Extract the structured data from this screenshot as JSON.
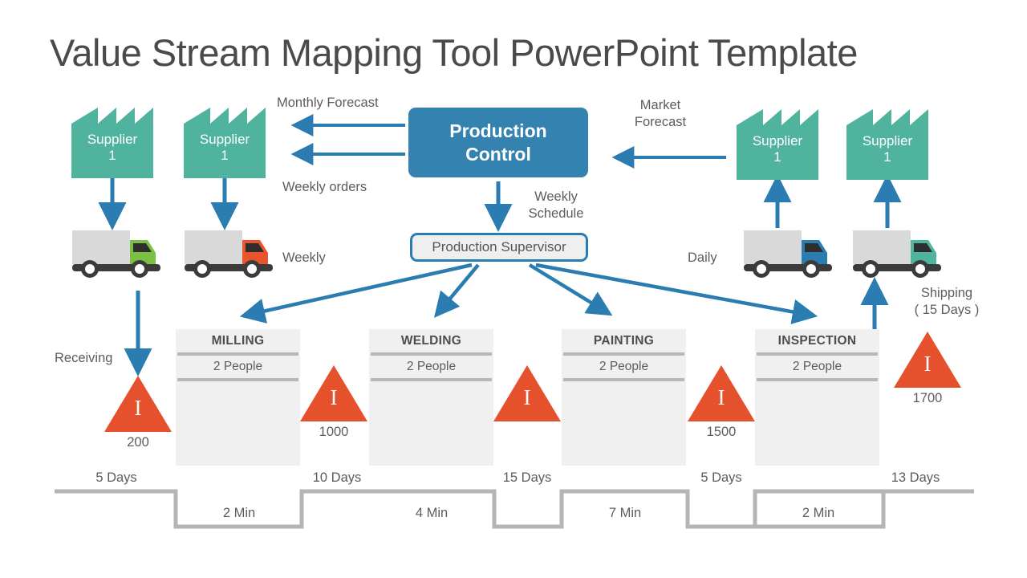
{
  "page_title": "Value Stream Mapping Tool PowerPoint Template",
  "colors": {
    "supplier_teal": "#4fb39d",
    "control_blue": "#3382b0",
    "arrow_blue": "#2b7cb0",
    "inventory_orange": "#e5512c",
    "process_gray": "#f0f0f0",
    "rule_gray": "#b8b8b8",
    "timeline_gray": "#b5b5b5",
    "text_gray": "#5c5c5c",
    "title_gray": "#4a4a4a",
    "truck_body_gray": "#d9d9d9",
    "truck_chassis": "#3b3b3b"
  },
  "production_control": {
    "line1": "Production",
    "line2": "Control"
  },
  "production_supervisor": {
    "label": "Production Supervisor"
  },
  "suppliers": [
    {
      "id": "supplier-left-1",
      "line1": "Supplier",
      "line2": "1"
    },
    {
      "id": "supplier-left-2",
      "line1": "Supplier",
      "line2": "1"
    },
    {
      "id": "supplier-right-1",
      "line1": "Supplier",
      "line2": "1"
    },
    {
      "id": "supplier-right-2",
      "line1": "Supplier",
      "line2": "1"
    }
  ],
  "flow_labels": {
    "monthly_forecast": "Monthly Forecast",
    "weekly_orders": "Weekly orders",
    "market_forecast": "Market\nForecast",
    "weekly_schedule": "Weekly\nSchedule",
    "weekly": "Weekly",
    "daily": "Daily",
    "receiving": "Receiving",
    "shipping": "Shipping\n( 15 Days )"
  },
  "trucks": [
    {
      "id": "truck-receiving-green",
      "cab_color": "#7ac143"
    },
    {
      "id": "truck-receiving-orange",
      "cab_color": "#e8542b"
    },
    {
      "id": "truck-shipping-blue",
      "cab_color": "#2b7cb0"
    },
    {
      "id": "truck-shipping-teal",
      "cab_color": "#4fb39d"
    }
  ],
  "processes": [
    {
      "id": "process-milling",
      "title": "MILLING",
      "people": "2 People"
    },
    {
      "id": "process-welding",
      "title": "WELDING",
      "people": "2 People"
    },
    {
      "id": "process-painting",
      "title": "PAINTING",
      "people": "2 People"
    },
    {
      "id": "process-inspection",
      "title": "INSPECTION",
      "people": "2 People"
    }
  ],
  "inventories": [
    {
      "id": "inventory-200",
      "glyph": "I",
      "value": "200"
    },
    {
      "id": "inventory-1000",
      "glyph": "I",
      "value": "1000"
    },
    {
      "id": "inventory-1500-a",
      "glyph": "I",
      "value": ""
    },
    {
      "id": "inventory-1500",
      "glyph": "I",
      "value": "1500"
    },
    {
      "id": "inventory-1700",
      "glyph": "I",
      "value": "1700"
    }
  ],
  "inventory_mid": {
    "glyph": "I",
    "value": ""
  },
  "timeline": {
    "lead_times": [
      "5 Days",
      "10 Days",
      "15 Days",
      "5 Days",
      "13 Days"
    ],
    "process_times": [
      "2 Min",
      "4 Min",
      "7 Min",
      "2 Min"
    ]
  }
}
